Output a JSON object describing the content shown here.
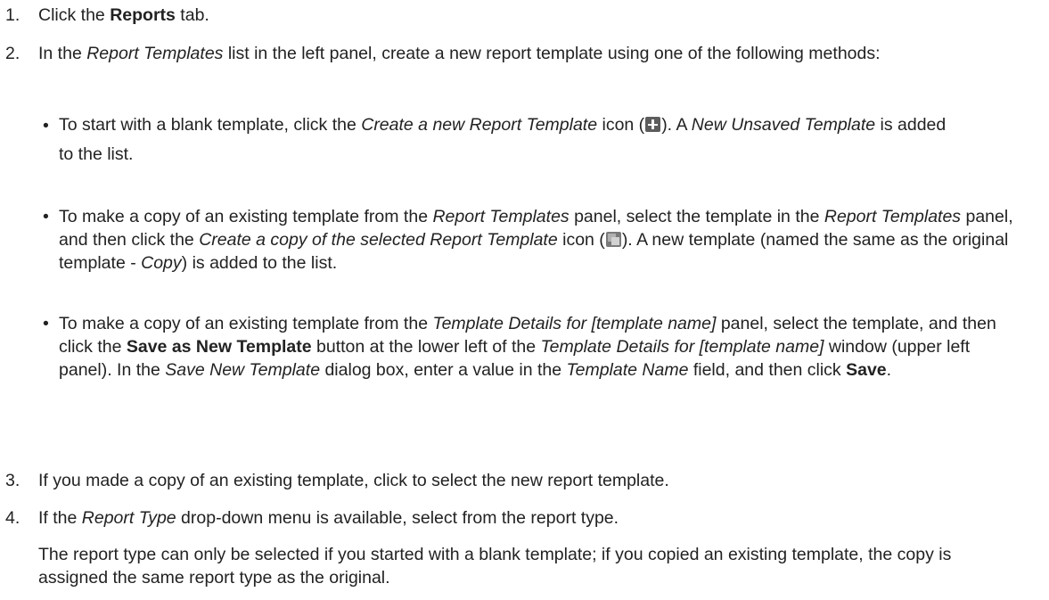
{
  "steps": [
    {
      "num": "1.",
      "pre": "Click the ",
      "bold": "Reports",
      "post": " tab."
    },
    {
      "num": "2.",
      "t1": "In the ",
      "i1": "Report Templates",
      "t2": " list in the left panel, create a new report template using one of the following methods:"
    },
    {
      "num": "3.",
      "text": "If you made a copy of an existing template, click to select the new report template."
    },
    {
      "num": "4.",
      "t1": "If the ",
      "i1": "Report Type",
      "t2": " drop-down menu is available, select from the report type.",
      "note": "The report type can only be selected if you started with a blank template; if you copied an existing template, the copy is assigned the same report type as the original."
    }
  ],
  "bullets": [
    {
      "t1": "To start with a blank template, click the ",
      "i1": "Create a new Report Template",
      "t2": " icon (",
      "t3": "). A ",
      "i2": "New Unsaved Template",
      "t4": " is added to the list."
    },
    {
      "t1": "To make a copy of an existing template from the ",
      "i1": "Report Templates",
      "t2": " panel, select the template in the ",
      "i2": "Report Templates",
      "t3": " panel, and then click the ",
      "i3": "Create a copy of the selected Report Template",
      "t4": " icon (",
      "t5": "). A new template (named the same as the original template - ",
      "i4": "Copy",
      "t6": ") is added to the list."
    },
    {
      "t1": "To make a copy of an existing template from the ",
      "i1": "Template Details for [template name]",
      "t2": " panel, select the template, and then click the ",
      "b1": "Save as New Template",
      "t3": " button at the lower left of the ",
      "i2": "Template Details for [template name]",
      "t4": " window (upper left panel). In the ",
      "i3": "Save New Template",
      "t5": " dialog box, enter a value in the ",
      "i4": "Template Name",
      "t6": " field, and then click ",
      "b2": "Save",
      "t7": "."
    }
  ],
  "icons": {
    "create": "plus-icon",
    "copy": "copy-icon"
  }
}
